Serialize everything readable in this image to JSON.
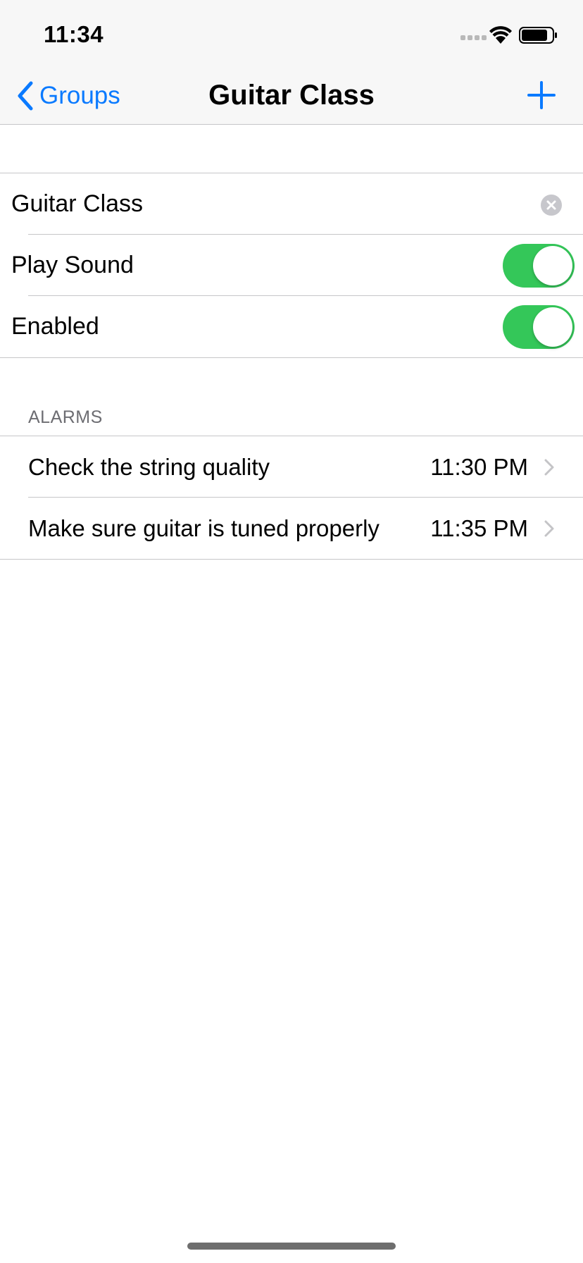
{
  "status_bar": {
    "time": "11:34",
    "icons": [
      "signal-icon",
      "wifi-icon",
      "battery-icon"
    ]
  },
  "nav": {
    "back_label": "Groups",
    "title": "Guitar Class",
    "add_icon": "plus-icon"
  },
  "settings": {
    "name_value": "Guitar Class",
    "play_sound_label": "Play Sound",
    "play_sound_on": true,
    "enabled_label": "Enabled",
    "enabled_on": true
  },
  "alarms": {
    "header": "ALARMS",
    "items": [
      {
        "label": "Check the string quality",
        "time": "11:30 PM"
      },
      {
        "label": "Make sure guitar is tuned properly",
        "time": "11:35 PM"
      }
    ]
  },
  "colors": {
    "accent": "#0a7aff",
    "toggle_on": "#34c759",
    "separator": "#c6c6c8",
    "secondary_text": "#6d6d72"
  }
}
